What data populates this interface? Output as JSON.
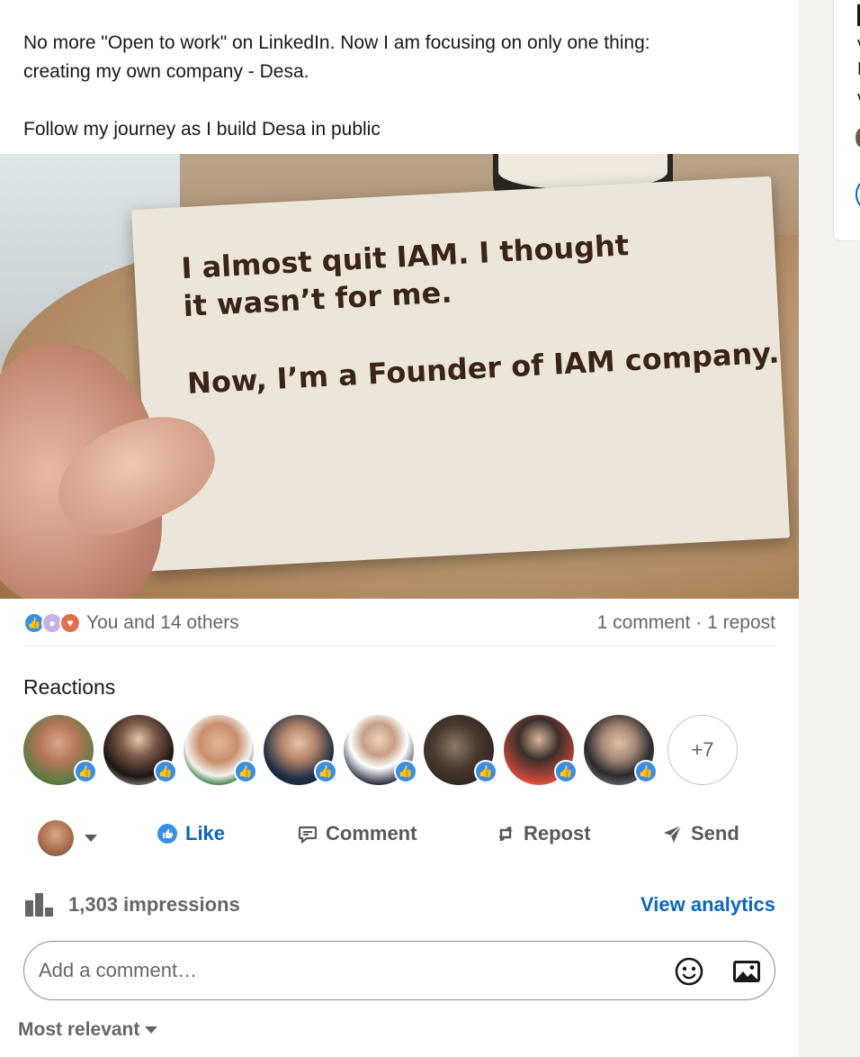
{
  "post": {
    "text_line1": "No more \"Open to work\" on LinkedIn. Now I am focusing on only one thing:",
    "text_line2": "creating my own company - Desa.",
    "text_line3": "Follow my journey as I build Desa in public",
    "image": {
      "card_line1": "I almost quit IAM. I thought",
      "card_line2": "it wasn’t for me.",
      "card_line3": "Now, I’m a Founder of IAM company."
    }
  },
  "social": {
    "reactions_summary": "You and 14 others",
    "comments_reposts": "1 comment · 1 repost"
  },
  "reactions": {
    "title": "Reactions",
    "more_count": "+7",
    "avatars": [
      "like",
      "like",
      "like",
      "like",
      "like",
      "like",
      "like",
      "like"
    ]
  },
  "actions": {
    "like": "Like",
    "comment": "Comment",
    "repost": "Repost",
    "send": "Send"
  },
  "analytics": {
    "impressions": "1,303 impressions",
    "view_link": "View analytics"
  },
  "comment": {
    "placeholder": "Add a comment…"
  },
  "sort": {
    "label": "Most relevant"
  },
  "colors": {
    "accent": "#0a66c2",
    "like": "#378fe9",
    "love": "#df704d"
  }
}
